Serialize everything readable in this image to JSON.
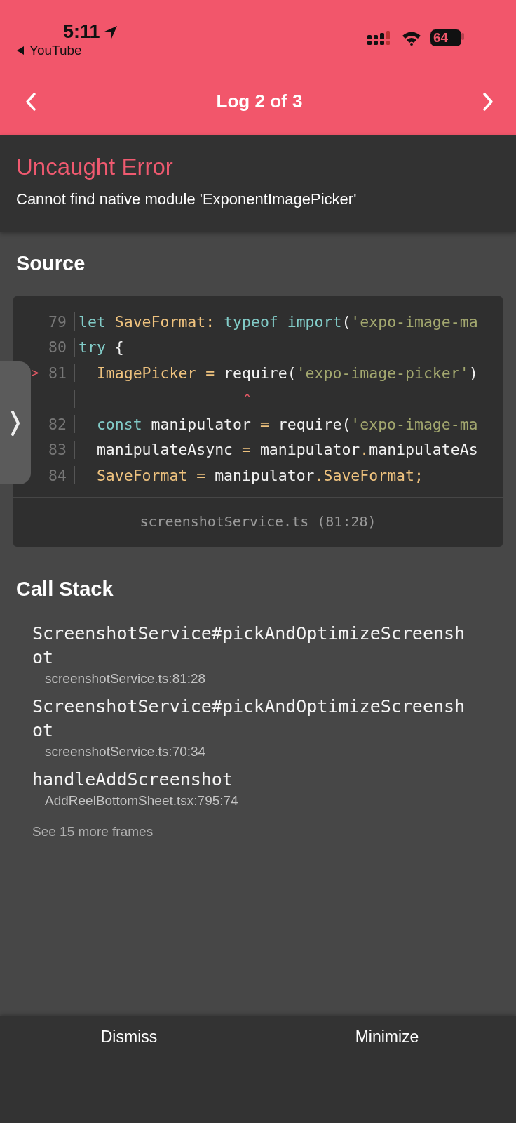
{
  "status_bar": {
    "time": "5:11",
    "back_app": "YouTube",
    "battery": "64"
  },
  "nav": {
    "title": "Log 2 of 3"
  },
  "error": {
    "title": "Uncaught Error",
    "message": "Cannot find native module 'ExponentImagePicker'"
  },
  "source": {
    "heading": "Source",
    "lines": [
      {
        "kind": "code",
        "number": "79",
        "tokens": [
          {
            "kind": "keyword",
            "text": "let "
          },
          {
            "kind": "name",
            "text": "SaveFormat"
          },
          {
            "kind": "operator",
            "text": ": "
          },
          {
            "kind": "keyword",
            "text": "typeof import"
          },
          {
            "kind": "plain",
            "text": "("
          },
          {
            "kind": "string",
            "text": "'expo-image-ma"
          }
        ]
      },
      {
        "kind": "code",
        "number": "80",
        "tokens": [
          {
            "kind": "keyword",
            "text": "try"
          },
          {
            "kind": "plain",
            "text": " {"
          }
        ]
      },
      {
        "kind": "code",
        "number": "81",
        "marker": ">",
        "tokens": [
          {
            "kind": "name",
            "text": "  ImagePicker "
          },
          {
            "kind": "operator",
            "text": "="
          },
          {
            "kind": "plain",
            "text": " require("
          },
          {
            "kind": "string",
            "text": "'expo-image-picker'"
          },
          {
            "kind": "plain",
            "text": ")"
          }
        ]
      },
      {
        "kind": "caret",
        "text": "                       ^"
      },
      {
        "kind": "code",
        "number": "82",
        "tokens": [
          {
            "kind": "keyword",
            "text": "  const"
          },
          {
            "kind": "plain",
            "text": " manipulator "
          },
          {
            "kind": "operator",
            "text": "="
          },
          {
            "kind": "plain",
            "text": " require("
          },
          {
            "kind": "string",
            "text": "'expo-image-ma"
          }
        ]
      },
      {
        "kind": "code",
        "number": "83",
        "tokens": [
          {
            "kind": "plain",
            "text": "  manipulateAsync "
          },
          {
            "kind": "operator",
            "text": "="
          },
          {
            "kind": "plain",
            "text": " manipulator"
          },
          {
            "kind": "operator",
            "text": "."
          },
          {
            "kind": "plain",
            "text": "manipulateAs"
          }
        ]
      },
      {
        "kind": "code",
        "number": "84",
        "tokens": [
          {
            "kind": "name",
            "text": "  SaveFormat "
          },
          {
            "kind": "operator",
            "text": "="
          },
          {
            "kind": "plain",
            "text": " manipulator"
          },
          {
            "kind": "operator",
            "text": "."
          },
          {
            "kind": "name",
            "text": "SaveFormat;"
          }
        ]
      }
    ],
    "file": "screenshotService.ts (81:28)"
  },
  "call_stack": {
    "heading": "Call Stack",
    "frames": [
      {
        "name": "ScreenshotService#pickAndOptimizeScreenshot",
        "location": "screenshotService.ts:81:28"
      },
      {
        "name": "ScreenshotService#pickAndOptimizeScreenshot",
        "location": "screenshotService.ts:70:34"
      },
      {
        "name": "handleAddScreenshot",
        "location": "AddReelBottomSheet.tsx:795:74"
      }
    ],
    "more": "See 15 more frames"
  },
  "buttons": [
    {
      "label": "Dismiss"
    },
    {
      "label": "Minimize"
    }
  ]
}
